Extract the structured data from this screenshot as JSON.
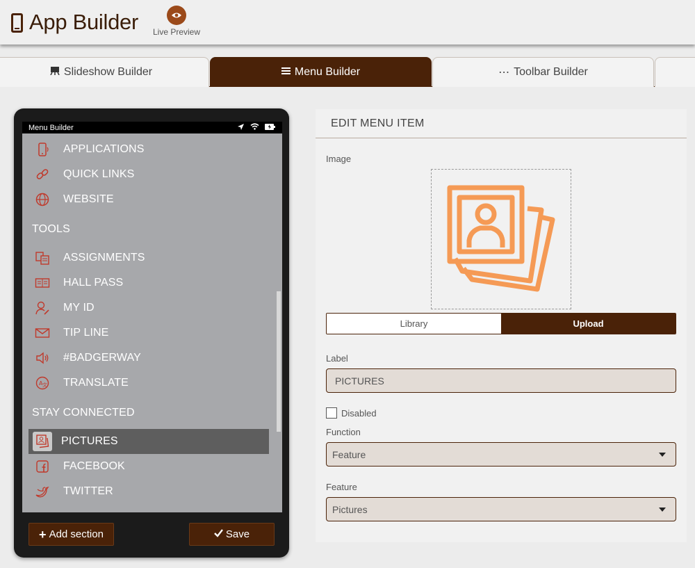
{
  "header": {
    "title": "App Builder",
    "live_preview_label": "Live Preview"
  },
  "tabs": [
    {
      "label": "Slideshow Builder",
      "icon": "easel-icon",
      "active": false
    },
    {
      "label": "Menu Builder",
      "icon": "menu-icon",
      "active": true
    },
    {
      "label": "Toolbar Builder",
      "icon": "ellipsis-icon",
      "active": false
    }
  ],
  "phone": {
    "status_title": "Menu Builder",
    "items": [
      {
        "label": "APPLICATIONS",
        "icon": "mobile-icon"
      },
      {
        "label": "QUICK LINKS",
        "icon": "link-icon"
      },
      {
        "label": "WEBSITE",
        "icon": "globe-icon"
      },
      {
        "label": "ASSIGNMENTS",
        "icon": "assignments-icon"
      },
      {
        "label": "HALL PASS",
        "icon": "hall-pass-icon"
      },
      {
        "label": "MY ID",
        "icon": "user-edit-icon"
      },
      {
        "label": "TIP LINE",
        "icon": "envelope-icon"
      },
      {
        "label": "#BADGERWAY",
        "icon": "megaphone-icon"
      },
      {
        "label": "TRANSLATE",
        "icon": "translate-icon"
      },
      {
        "label": "PICTURES",
        "icon": "pictures-icon",
        "selected": true
      },
      {
        "label": "FACEBOOK",
        "icon": "facebook-icon"
      },
      {
        "label": "TWITTER",
        "icon": "twitter-icon"
      }
    ],
    "sections": [
      "TOOLS",
      "STAY CONNECTED"
    ],
    "add_section_label": "Add section",
    "save_label": "Save"
  },
  "panel": {
    "title": "EDIT MENU ITEM",
    "image_label": "Image",
    "library_label": "Library",
    "upload_label": "Upload",
    "label_label": "Label",
    "label_value": "PICTURES",
    "disabled_label": "Disabled",
    "disabled_checked": false,
    "function_label": "Function",
    "function_value": "Feature",
    "feature_label": "Feature",
    "feature_value": "Pictures"
  },
  "colors": {
    "brand_dark": "#4a2208",
    "accent_orange": "#f59a55",
    "menu_icon_red": "#c0392b"
  }
}
